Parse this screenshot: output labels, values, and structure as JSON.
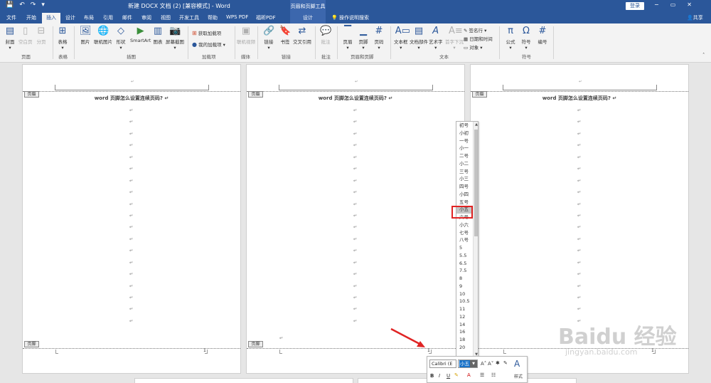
{
  "titlebar": {
    "doc_title": "新建 DOCX 文档 (2) [兼容模式] - Word",
    "context_tools": "页眉和页脚工具",
    "login": "登录",
    "minimize": "−",
    "restore": "▭",
    "close": "✕"
  },
  "tabs": [
    "文件",
    "开始",
    "插入",
    "设计",
    "布局",
    "引用",
    "邮件",
    "审阅",
    "视图",
    "开发工具",
    "帮助",
    "WPS PDF",
    "福昕PDF"
  ],
  "active_tab": "插入",
  "context_tab": "设计",
  "search_label": "操作说明搜索",
  "share_label": "共享",
  "ribbon": {
    "pages_group": {
      "cover": "封面",
      "blank": "空白页",
      "break": "分页",
      "label": "页面"
    },
    "tables_group": {
      "table": "表格",
      "label": "表格"
    },
    "illus_group": {
      "picture": "图片",
      "online_picture": "联机图片",
      "shapes": "形状",
      "smartart": "SmartArt",
      "chart": "图表",
      "screenshot": "屏幕截图",
      "label": "插图"
    },
    "addins_group": {
      "get": "获取加载项",
      "my": "我的加载项",
      "label": "加载项"
    },
    "media_group": {
      "video": "联机视频",
      "label": "媒体"
    },
    "links_group": {
      "link": "链接",
      "bookmark": "书签",
      "crossref": "交叉引用",
      "label": "链接"
    },
    "comments_group": {
      "comment": "批注",
      "label": "批注"
    },
    "hf_group": {
      "header": "页眉",
      "footer": "页脚",
      "pagenum": "页码",
      "label": "页眉和页脚"
    },
    "text_group": {
      "textbox": "文本框",
      "docparts": "文档部件",
      "wordart": "艺术字",
      "dropcap": "首字下沉",
      "sigline": "签名行",
      "datetime": "日期和时间",
      "object": "对象",
      "label": "文本"
    },
    "symbols_group": {
      "equation": "公式",
      "symbol": "符号",
      "number": "编号",
      "label": "符号"
    }
  },
  "document": {
    "heading": "word 页脚怎么设置连续页码? ↵",
    "header_tag": "页眉",
    "footer_tag": "页脚",
    "para_mark": "↵",
    "page_number": "1",
    "footer_cursor": "1"
  },
  "size_options": [
    "初号",
    "小初",
    "一号",
    "小一",
    "二号",
    "小二",
    "三号",
    "小三",
    "四号",
    "小四",
    "五号",
    "小五",
    "六号",
    "小六",
    "七号",
    "八号",
    "5",
    "5.5",
    "6.5",
    "7.5",
    "8",
    "9",
    "10",
    "10.5",
    "11",
    "12",
    "14",
    "16",
    "18",
    "20"
  ],
  "selected_size": "小五",
  "mini_toolbar": {
    "font": "Calibri (E",
    "size": "小五",
    "grow": "A˄",
    "shrink": "A˅",
    "bold": "B",
    "italic": "I",
    "underline": "U",
    "styles": "样式"
  },
  "watermark": {
    "logo": "Baidu 经验",
    "url": "jingyan.baidu.com"
  },
  "colors": {
    "accent": "#2b579a",
    "highlight": "#e02424",
    "selection": "#1a73c9"
  }
}
